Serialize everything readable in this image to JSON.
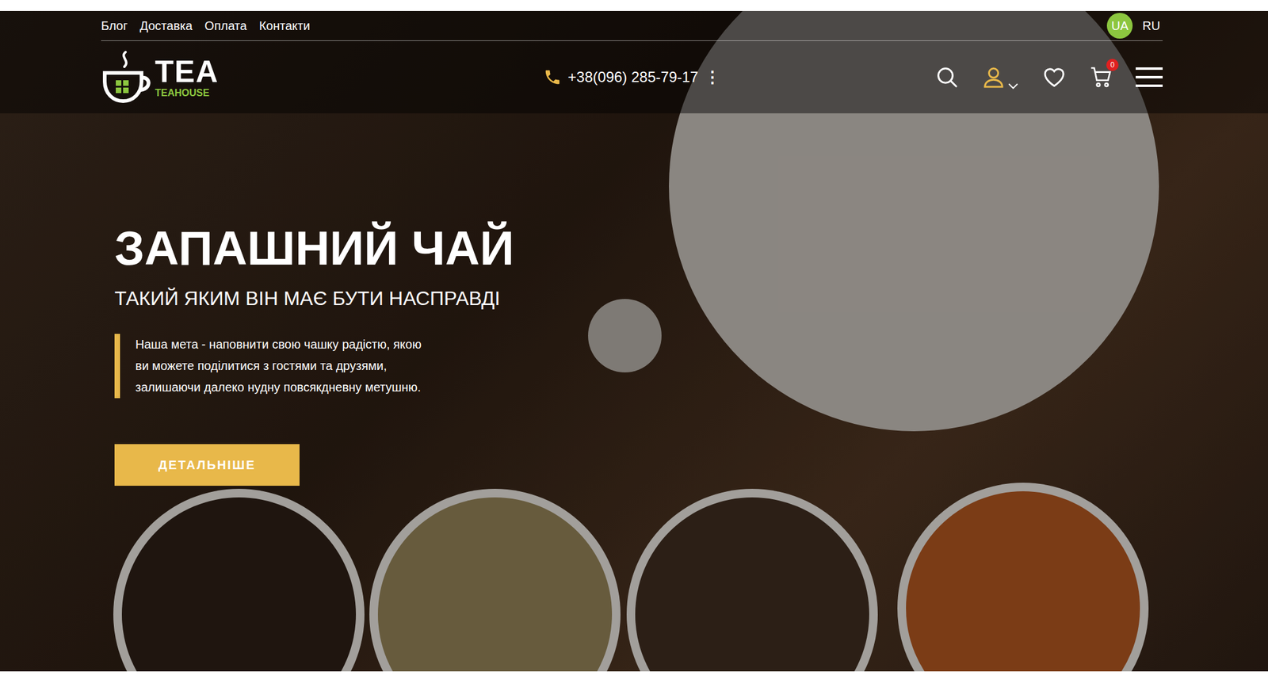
{
  "top_nav": {
    "links": [
      "Блог",
      "Доставка",
      "Оплата",
      "Контакти"
    ],
    "languages": [
      {
        "label": "UA",
        "selected": true
      },
      {
        "label": "RU",
        "selected": false
      }
    ]
  },
  "header": {
    "logo": {
      "title": "TEA",
      "subtitle": "TEAHOUSE"
    },
    "phone": "+38(096) 285-79-17",
    "phone_menu": "⋮",
    "cart_count": "0"
  },
  "hero": {
    "title": "ЗАПАШНИЙ ЧАЙ",
    "subtitle": "ТАКИЙ ЯКИМ ВІН МАЄ БУТИ НАСПРАВДІ",
    "description": [
      "Наша мета - наповнити свою чашку радістю, якою",
      "ви можете поділитися з гостями та друзями,",
      "залишаючи далеко нудну повсякдневну метушню."
    ],
    "button": "ДЕТАЛЬНІШЕ"
  }
}
